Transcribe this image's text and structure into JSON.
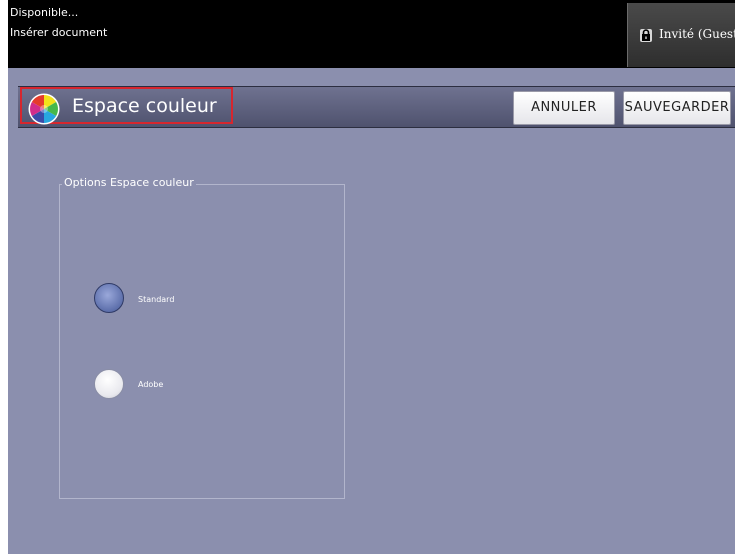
{
  "status": {
    "line1": "Disponible...",
    "line2": "Insérer document"
  },
  "user": {
    "label": "Invité (Guest",
    "icon": "lock-icon"
  },
  "header": {
    "title": "Espace couleur",
    "icon": "color-wheel-icon",
    "cancel_label": "ANNULER",
    "save_label": "SAUVEGARDER",
    "highlight_color": "#d6262e"
  },
  "options": {
    "legend": "Options Espace couleur",
    "items": [
      {
        "label": "Standard",
        "selected": true
      },
      {
        "label": "Adobe",
        "selected": false
      }
    ]
  },
  "colors": {
    "background": "#8b8fae",
    "statusbar": "#000000",
    "radio_selected": "#5d6fab"
  }
}
